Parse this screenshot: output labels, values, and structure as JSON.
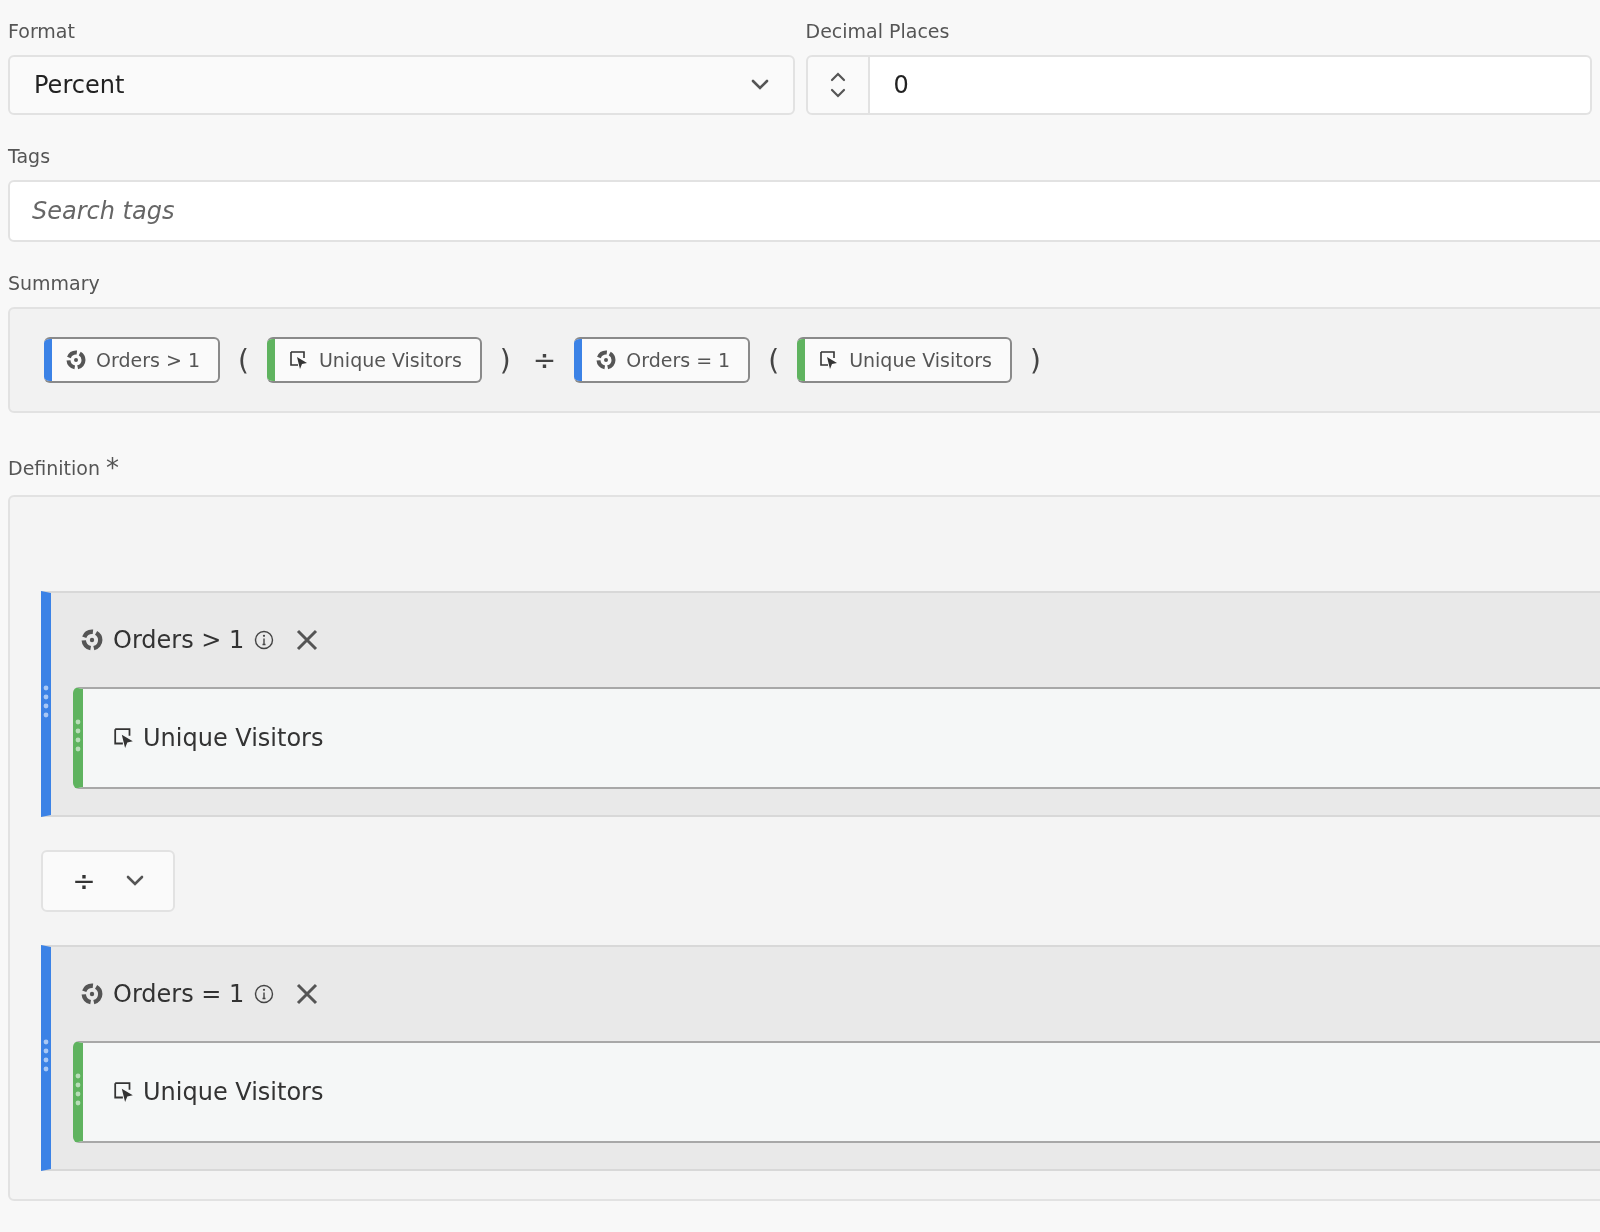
{
  "format": {
    "label": "Format",
    "value": "Percent"
  },
  "decimal_places": {
    "label": "Decimal Places",
    "value": "0"
  },
  "tags": {
    "label": "Tags",
    "placeholder": "Search tags"
  },
  "summary": {
    "label": "Summary",
    "items": [
      {
        "kind": "segment",
        "text": "Orders > 1",
        "color": "#3b82e6"
      },
      {
        "kind": "symbol",
        "text": "("
      },
      {
        "kind": "metric",
        "text": "Unique Visitors",
        "color": "#5fb35f"
      },
      {
        "kind": "symbol",
        "text": ")"
      },
      {
        "kind": "symbol",
        "text": "÷"
      },
      {
        "kind": "segment",
        "text": "Orders = 1",
        "color": "#3b82e6"
      },
      {
        "kind": "symbol",
        "text": "("
      },
      {
        "kind": "metric",
        "text": "Unique Visitors",
        "color": "#5fb35f"
      },
      {
        "kind": "symbol",
        "text": ")"
      }
    ]
  },
  "definition": {
    "label": "Definition",
    "required_mark": "*",
    "blocks": [
      {
        "kind": "container",
        "title": "Orders > 1",
        "color": "#3b82e6",
        "children": [
          {
            "kind": "metric",
            "text": "Unique Visitors",
            "color": "#5fb35f"
          }
        ]
      },
      {
        "kind": "operator",
        "symbol": "÷"
      },
      {
        "kind": "container",
        "title": "Orders = 1",
        "color": "#3b82e6",
        "children": [
          {
            "kind": "metric",
            "text": "Unique Visitors",
            "color": "#5fb35f"
          }
        ]
      }
    ]
  }
}
